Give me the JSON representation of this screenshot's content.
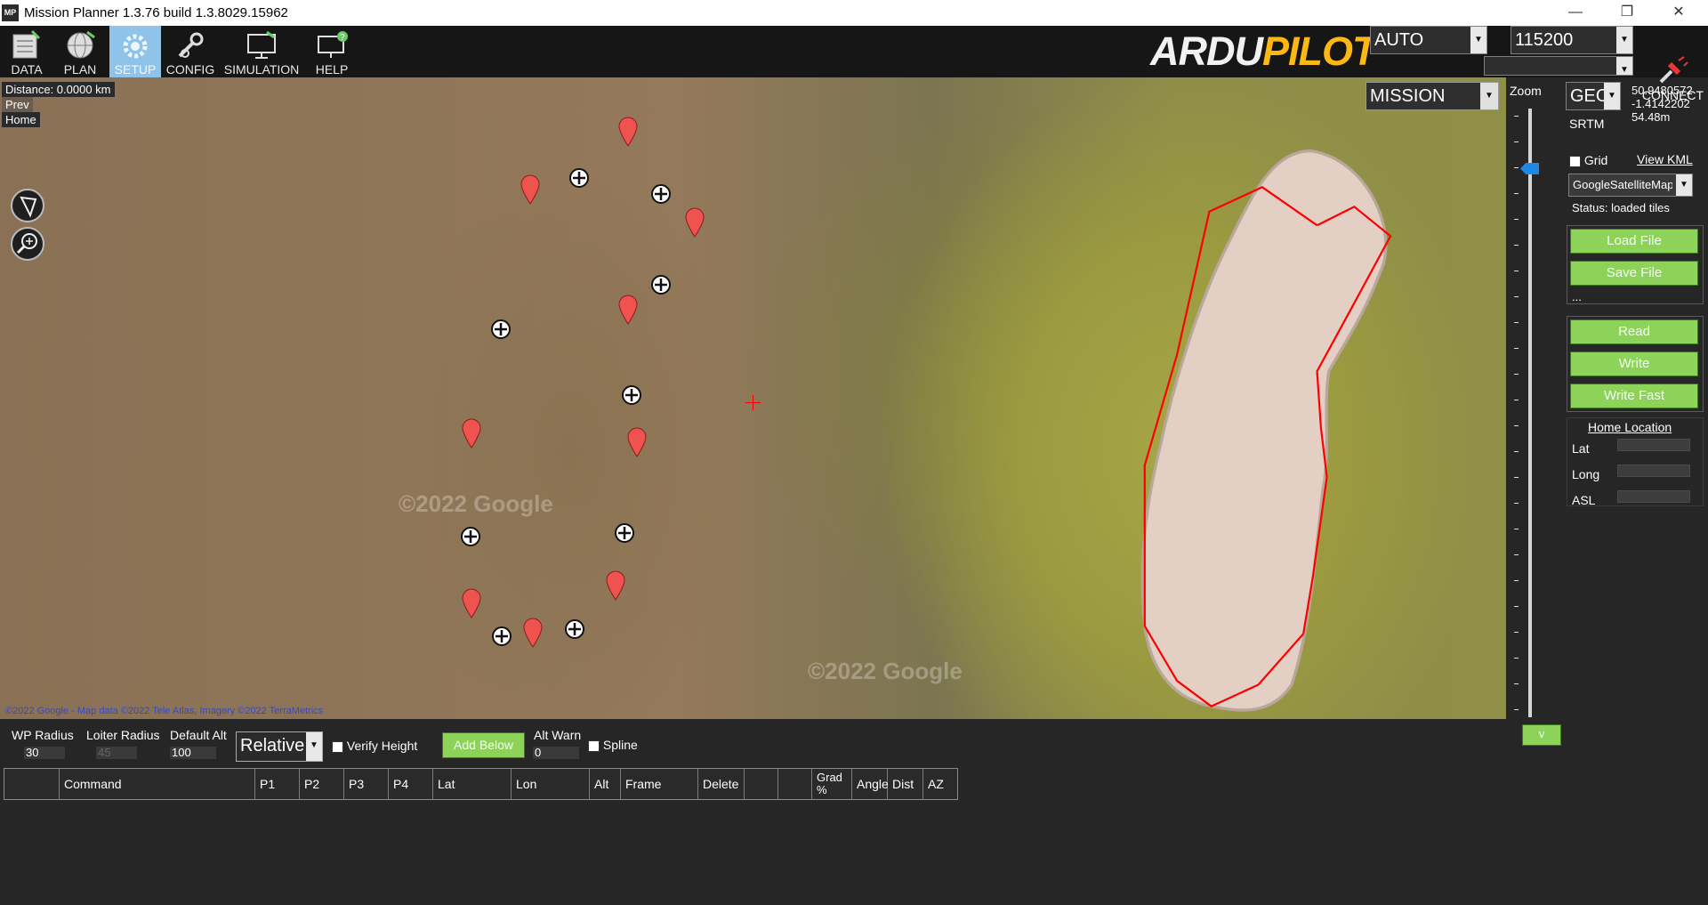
{
  "window": {
    "title": "Mission Planner 1.3.76 build 1.3.8029.15962",
    "icon_text": "MP"
  },
  "toolbar": {
    "buttons": [
      {
        "label": "DATA",
        "icon": "data-icon"
      },
      {
        "label": "PLAN",
        "icon": "globe-icon"
      },
      {
        "label": "SETUP",
        "icon": "gear-icon",
        "active": true
      },
      {
        "label": "CONFIG",
        "icon": "wrench-icon"
      },
      {
        "label": "SIMULATION",
        "icon": "monitor-icon"
      },
      {
        "label": "HELP",
        "icon": "help-icon"
      }
    ],
    "logo_ardu": "ARDU",
    "logo_pilot": "PILOT",
    "mode_value": "AUTO",
    "baud_value": "115200",
    "connect_label": "CONNECT"
  },
  "map": {
    "distance": "Distance: 0.0000 km",
    "prev": "Prev",
    "home": "Home",
    "copyright": "©2022 Google - Map data ©2022 Tele Atlas, Imagery ©2022 TerraMetrics",
    "watermark1": "©2022 Google",
    "watermark2": "©2022 Google",
    "mission_value": "MISSION",
    "zoom_label": "Zoom"
  },
  "right_panel": {
    "coord_type": "GEO",
    "lat": "50.9480572",
    "lon": "-1.4142202",
    "alt": "54.48m",
    "srtm": "SRTM",
    "grid_label": "Grid",
    "view_kml": "View KML",
    "map_type": "GoogleSatelliteMap",
    "status": "Status: loaded tiles",
    "load_file": "Load File",
    "save_file": "Save File",
    "ellipsis": "...",
    "read": "Read",
    "write": "Write",
    "write_fast": "Write Fast",
    "home_location": "Home Location",
    "home_lat_label": "Lat",
    "home_long_label": "Long",
    "home_asl_label": "ASL"
  },
  "bottom": {
    "wp_radius_label": "WP Radius",
    "wp_radius_value": "30",
    "loiter_radius_label": "Loiter Radius",
    "loiter_radius_value": "45",
    "default_alt_label": "Default Alt",
    "default_alt_value": "100",
    "frame_value": "Relative",
    "verify_height_label": "Verify Height",
    "add_below_label": "Add Below",
    "alt_warn_label": "Alt Warn",
    "alt_warn_value": "0",
    "spline_label": "Spline",
    "collapse_label": "v",
    "columns": [
      "",
      "Command",
      "P1",
      "P2",
      "P3",
      "P4",
      "Lat",
      "Lon",
      "Alt",
      "Frame",
      "Delete",
      "",
      "",
      "Grad %",
      "Angle",
      "Dist",
      "AZ"
    ]
  },
  "colors": {
    "accent_green": "#8dd35a",
    "active_tab": "#8fc3ea",
    "path_red": "#ff0000",
    "logo_yellow": "#fdb813"
  }
}
